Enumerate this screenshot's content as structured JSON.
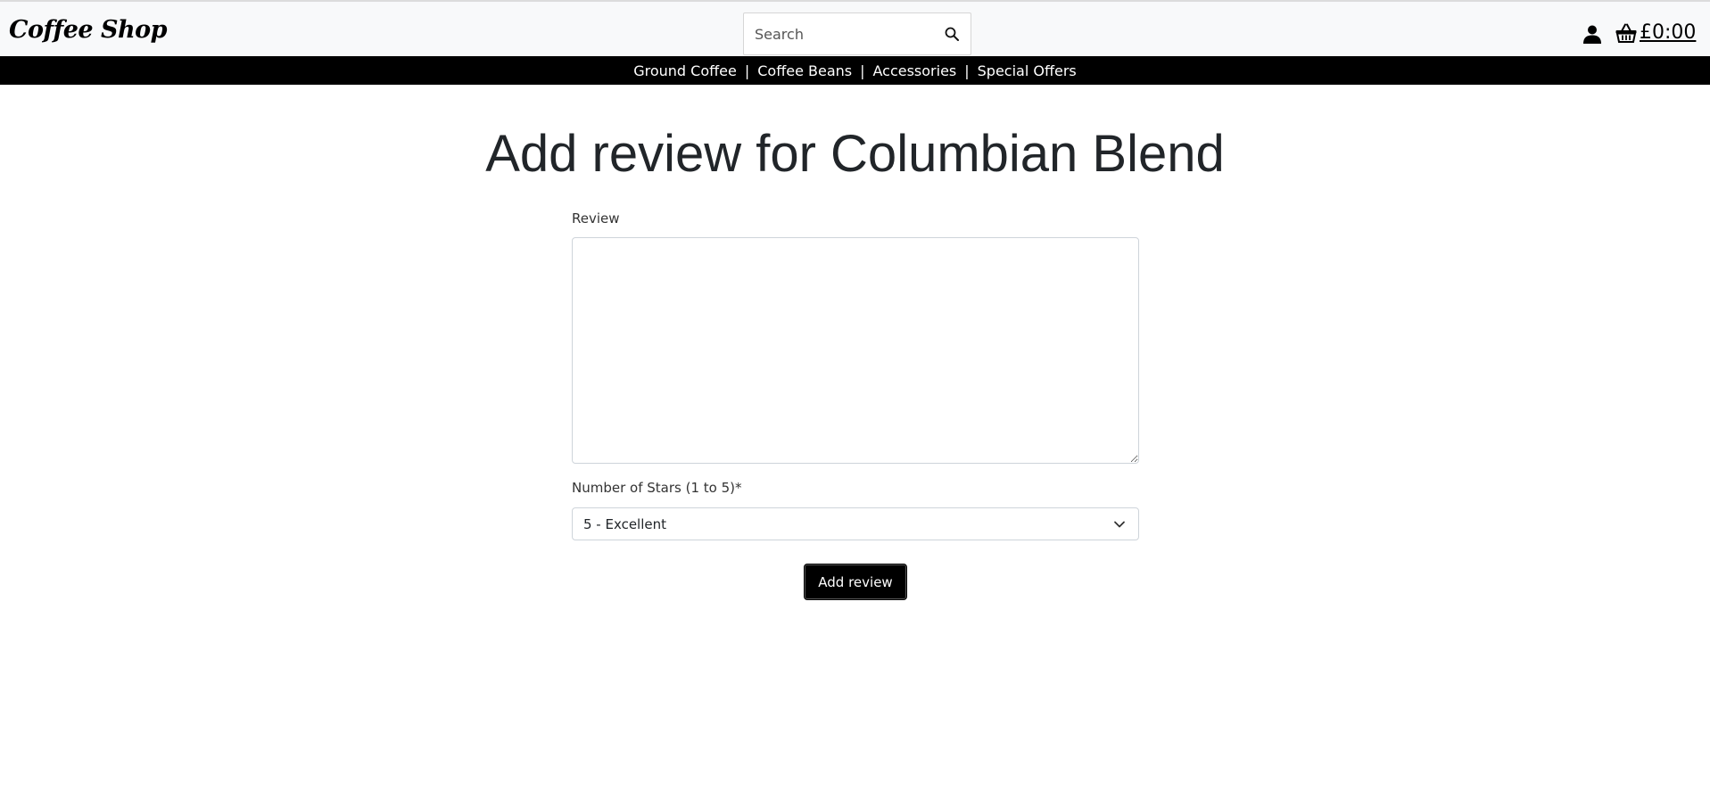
{
  "header": {
    "logo_text": "Coffee Shop",
    "search_placeholder": "Search",
    "basket_total": "£0:00"
  },
  "nav": {
    "items": [
      {
        "label": "Ground Coffee"
      },
      {
        "label": "Coffee Beans"
      },
      {
        "label": "Accessories"
      },
      {
        "label": "Special Offers"
      }
    ],
    "separator": "|"
  },
  "page": {
    "title": "Add review for Columbian Blend"
  },
  "form": {
    "review_label": "Review",
    "review_value": "",
    "stars_label": "Number of Stars (1 to 5)*",
    "stars_selected": "5 - Excellent",
    "submit_label": "Add review"
  },
  "icons": {
    "search": "search-icon",
    "account": "user-icon",
    "basket": "basket-icon",
    "select": "chevron-down-icon"
  }
}
